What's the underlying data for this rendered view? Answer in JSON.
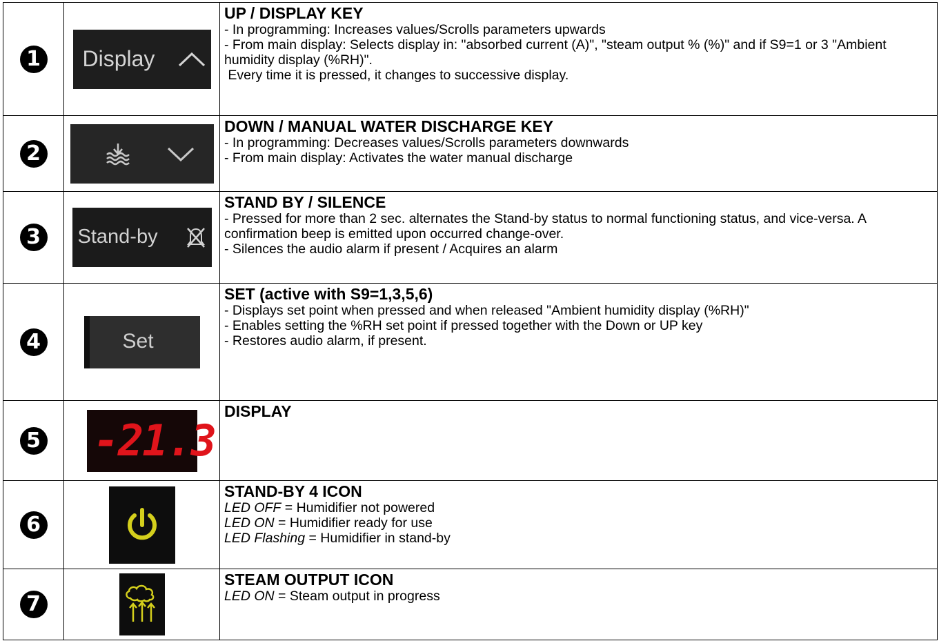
{
  "rows": [
    {
      "number": "1",
      "key_label": "Display",
      "key_icon": "chevron-up-icon",
      "title": "UP / DISPLAY KEY",
      "lines": [
        "- In programming: Increases values/Scrolls parameters upwards",
        "- From main display:  Selects display in: \"absorbed current (A)\", \"steam output % (%)\" and if S9=1 or 3 \"Ambient humidity display (%RH)\".",
        " Every time it is pressed, it changes to successive display."
      ]
    },
    {
      "number": "2",
      "key_icon": "water-discharge-icon",
      "key_icon2": "chevron-down-icon",
      "title": "DOWN / MANUAL WATER DISCHARGE KEY",
      "lines": [
        "- In programming:  Decreases values/Scrolls parameters downwards",
        "- From main display:  Activates the water manual discharge"
      ]
    },
    {
      "number": "3",
      "key_label": "Stand-by",
      "key_icon": "alarm-silence-icon",
      "title": "STAND BY / SILENCE",
      "lines": [
        "- Pressed for more than 2 sec. alternates the Stand-by status to normal functioning status, and vice-versa.  A confirmation beep is emitted upon occurred change-over.",
        "- Silences the audio alarm if present / Acquires an alarm"
      ]
    },
    {
      "number": "4",
      "key_label": "Set",
      "title": "SET (active with S9=1,3,5,6)",
      "lines": [
        "- Displays set point when pressed and when released \"Ambient humidity display (%RH)\"",
        "- Enables setting the %RH set point if pressed together with the Down or UP key",
        "- Restores audio alarm, if present."
      ]
    },
    {
      "number": "5",
      "display_reading": "-21.3",
      "title": "DISPLAY",
      "lines": []
    },
    {
      "number": "6",
      "key_icon": "power-icon",
      "title": "STAND-BY 4 ICON",
      "led_lines": [
        {
          "label": "LED OFF",
          "text": " = Humidifier not powered"
        },
        {
          "label": "LED ON",
          "text": " = Humidifier ready for use"
        },
        {
          "label": "LED Flashing",
          "text": " = Humidifier in stand-by"
        }
      ]
    },
    {
      "number": "7",
      "key_icon": "steam-output-icon",
      "title": "STEAM OUTPUT ICON",
      "led_lines": [
        {
          "label": "LED ON",
          "text": " = Steam output in progress"
        }
      ]
    }
  ],
  "colors": {
    "key_bg": "#1c1c1c",
    "key_text": "#d8d8d8",
    "led_red": "#e0141b",
    "icon_yellow": "#d4cf1c"
  }
}
